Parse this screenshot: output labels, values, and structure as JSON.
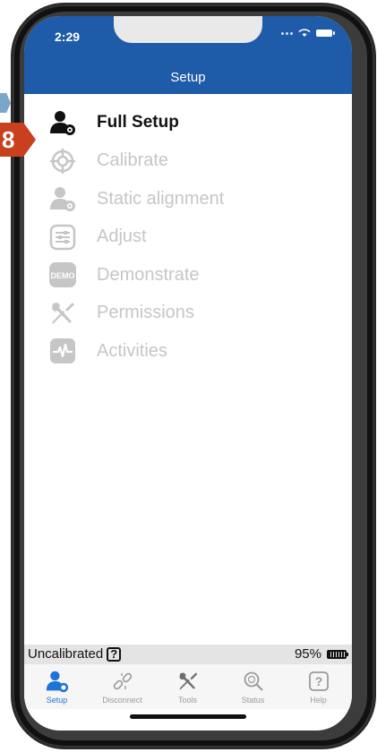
{
  "status_bar": {
    "time": "2:29"
  },
  "nav": {
    "title": "Setup"
  },
  "step_badge": "8",
  "menu": [
    {
      "label": "Full Setup",
      "icon": "user-gear-icon",
      "active": true
    },
    {
      "label": "Calibrate",
      "icon": "crosshair-icon",
      "active": false
    },
    {
      "label": "Static alignment",
      "icon": "user-gear-icon",
      "active": false
    },
    {
      "label": "Adjust",
      "icon": "sliders-icon",
      "active": false
    },
    {
      "label": "Demonstrate",
      "icon": "demo-icon",
      "active": false
    },
    {
      "label": "Permissions",
      "icon": "wrench-screwdriver-icon",
      "active": false
    },
    {
      "label": "Activities",
      "icon": "activity-icon",
      "active": false
    }
  ],
  "demo_icon_text": "DEMO",
  "device_status": {
    "calibration": "Uncalibrated",
    "help_mark": "?",
    "battery": "95%"
  },
  "tabs": [
    {
      "label": "Setup",
      "active": true
    },
    {
      "label": "Disconnect",
      "active": false
    },
    {
      "label": "Tools",
      "active": false
    },
    {
      "label": "Status",
      "active": false
    },
    {
      "label": "Help",
      "active": false
    }
  ],
  "colors": {
    "nav_blue": "#1e5ba9",
    "accent": "#1e74d6",
    "badge": "#c8401e",
    "disabled": "#c6c6c6"
  }
}
